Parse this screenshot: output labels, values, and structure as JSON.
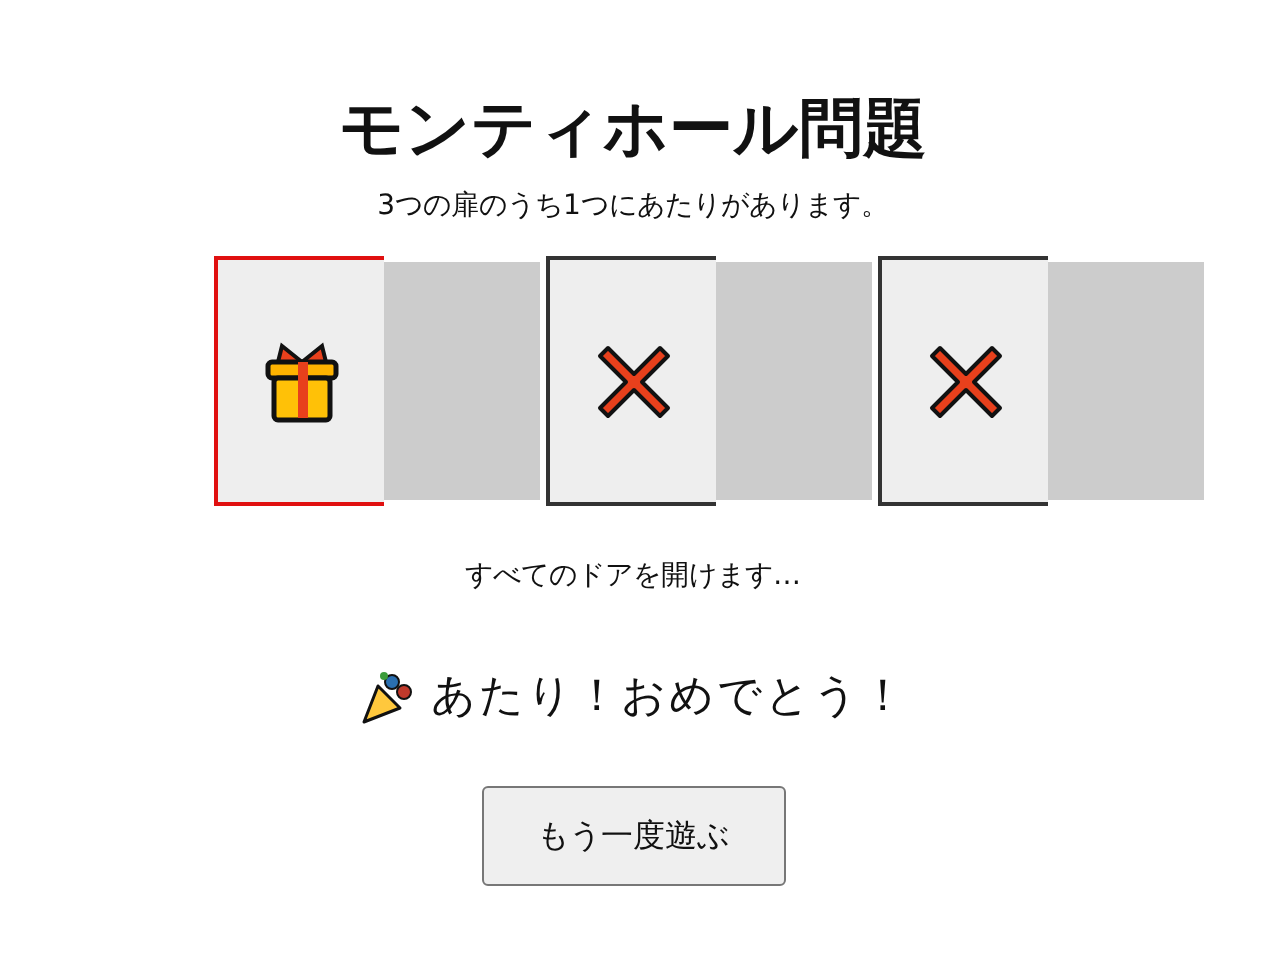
{
  "title": "モンティホール問題",
  "instructions": "3つの扉のうち1つにあたりがあります。",
  "doors": [
    {
      "kind": "prize",
      "selected": true,
      "open": true
    },
    {
      "kind": "miss",
      "selected": false,
      "open": true
    },
    {
      "kind": "miss",
      "selected": false,
      "open": true
    }
  ],
  "status": "すべてのドアを開けます…",
  "result": {
    "kind": "win",
    "text": "あたり！おめでとう！"
  },
  "button": "もう一度遊ぶ"
}
